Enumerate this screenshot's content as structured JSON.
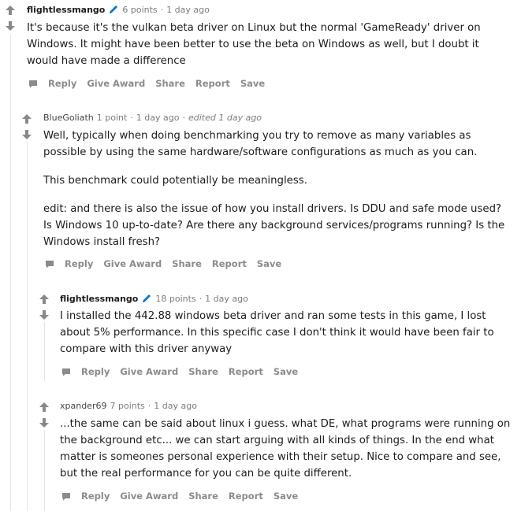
{
  "comments": [
    {
      "author": "flightlessmango",
      "points": "6 points",
      "time": "1 day ago",
      "edited": "",
      "paragraphs": [
        "It's because it's the vulkan beta driver on Linux but the normal 'GameReady' driver on Windows. It might have been better to use the beta on Windows as well, but I doubt it would have made a difference"
      ]
    },
    {
      "author": "BlueGoliath",
      "points": "1 point",
      "time": "1 day ago",
      "edited": "edited 1 day ago",
      "paragraphs": [
        "Well, typically when doing benchmarking you try to remove as many variables as possible by using the same hardware/software configurations as much as you can.",
        "This benchmark could potentially be meaningless.",
        "edit: and there is also the issue of how you install drivers. Is DDU and safe mode used? Is Windows 10 up-to-date? Are there any background services/programs running? Is the Windows install fresh?"
      ]
    },
    {
      "author": "flightlessmango",
      "points": "18 points",
      "time": "1 day ago",
      "edited": "",
      "paragraphs": [
        "I installed the 442.88 windows beta driver and ran some tests in this game, I lost about 5% performance. In this specific case I don't think it would have been fair to compare with this driver anyway"
      ]
    },
    {
      "author": "xpander69",
      "points": "7 points",
      "time": "1 day ago",
      "edited": "",
      "paragraphs": [
        "...the same can be said about linux i guess. what DE, what programs were running on the background etc... we can start arguing with all kinds of things. In the end what matter is someones personal experience with their setup. Nice to compare and see, but the real performance for you can be quite different."
      ]
    }
  ],
  "actions": {
    "reply": "Reply",
    "give_award": "Give Award",
    "share": "Share",
    "report": "Report",
    "save": "Save"
  },
  "meta_separator": "·",
  "icons": {
    "upvote": "arrow-up-icon",
    "downvote": "arrow-down-icon",
    "op_badge": "pen-icon",
    "reply": "chat-bubble-icon"
  },
  "colors": {
    "pen_badge": "#0079d3",
    "action_text": "#8b8b8b",
    "meta_text": "#7c7c7c",
    "thread_line": "#e3e3e3"
  }
}
